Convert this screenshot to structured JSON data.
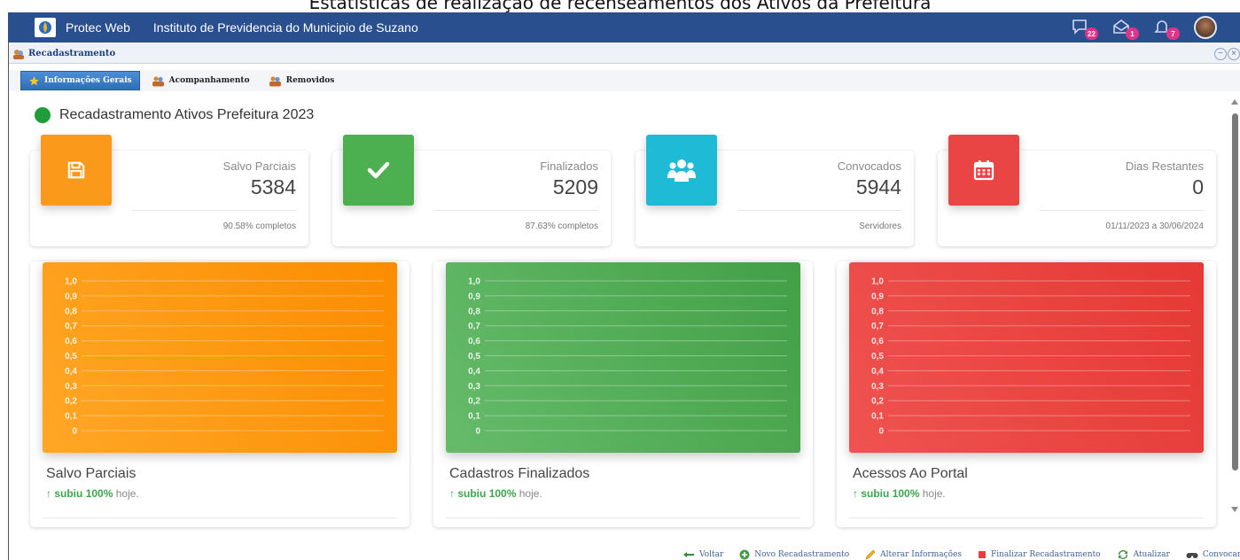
{
  "caption": "Estatísticas de realização de recenseamentos dos Ativos da Prefeitura",
  "header": {
    "app_name": "Protec Web",
    "institution": "Instituto de Previdencia do Municipio de Suzano",
    "notifications": [
      {
        "icon": "chat-icon",
        "count": "22"
      },
      {
        "icon": "envelope-icon",
        "count": "1"
      },
      {
        "icon": "bell-icon",
        "count": "7"
      }
    ]
  },
  "module": {
    "title": "Recadastramento"
  },
  "tabs": [
    {
      "label": "Informações Gerais",
      "icon": "star-icon",
      "active": true
    },
    {
      "label": "Acompanhamento",
      "icon": "people-icon",
      "active": false
    },
    {
      "label": "Removidos",
      "icon": "people-icon",
      "active": false
    }
  ],
  "section": {
    "title": "Recadastramento Ativos Prefeitura 2023"
  },
  "stats": [
    {
      "label": "Salvo Parciais",
      "value": "5384",
      "footer": "90.58% completos",
      "color": "#fb9a1a",
      "icon": "floppy-disk-icon"
    },
    {
      "label": "Finalizados",
      "value": "5209",
      "footer": "87.63% completos",
      "color": "#4caf50",
      "icon": "checkmark-icon"
    },
    {
      "label": "Convocados",
      "value": "5944",
      "footer": "Servidores",
      "color": "#1fbad6",
      "icon": "users-icon"
    },
    {
      "label": "Dias Restantes",
      "value": "0",
      "footer": "01/11/2023 a 30/06/2024",
      "color": "#ea4545",
      "icon": "calendar-icon"
    }
  ],
  "chart_data": [
    {
      "type": "line",
      "title": "Salvo Parciais",
      "ylim": [
        0,
        1
      ],
      "yticks": [
        "1,0",
        "0,9",
        "0,8",
        "0,7",
        "0,6",
        "0,5",
        "0,4",
        "0,3",
        "0,2",
        "0,1",
        "0"
      ],
      "series": [],
      "grid": true,
      "color": "#fb8c00",
      "trend_prefix": "subiu",
      "trend_value": "100%",
      "trend_suffix": "hoje."
    },
    {
      "type": "line",
      "title": "Cadastros Finalizados",
      "ylim": [
        0,
        1
      ],
      "yticks": [
        "1,0",
        "0,9",
        "0,8",
        "0,7",
        "0,6",
        "0,5",
        "0,4",
        "0,3",
        "0,2",
        "0,1",
        "0"
      ],
      "series": [],
      "grid": true,
      "color": "#43a047",
      "trend_prefix": "subiu",
      "trend_value": "100%",
      "trend_suffix": "hoje."
    },
    {
      "type": "line",
      "title": "Acessos Ao Portal",
      "ylim": [
        0,
        1
      ],
      "yticks": [
        "1,0",
        "0,9",
        "0,8",
        "0,7",
        "0,6",
        "0,5",
        "0,4",
        "0,3",
        "0,2",
        "0,1",
        "0"
      ],
      "series": [],
      "grid": true,
      "color": "#e53935",
      "trend_prefix": "subiu",
      "trend_value": "100%",
      "trend_suffix": "hoje."
    }
  ],
  "actions": [
    {
      "label": "Voltar",
      "icon": "back-arrow-icon"
    },
    {
      "label": "Novo Recadastramento",
      "icon": "plus-circle-icon"
    },
    {
      "label": "Alterar Informações",
      "icon": "pencil-icon"
    },
    {
      "label": "Finalizar Recadastramento",
      "icon": "stop-icon"
    },
    {
      "label": "Atualizar",
      "icon": "refresh-icon"
    },
    {
      "label": "Convocar",
      "icon": "binoculars-icon"
    }
  ]
}
